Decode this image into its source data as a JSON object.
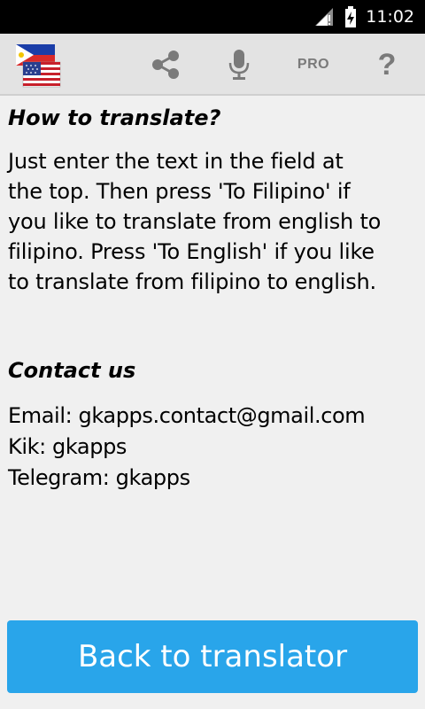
{
  "status_bar": {
    "time": "11:02",
    "icons": [
      "signal-icon",
      "battery-charging-icon"
    ]
  },
  "toolbar": {
    "logo": "flags-logo",
    "share_icon": "share-icon",
    "mic_icon": "microphone-icon",
    "pro_label": "PRO",
    "help_label": "?"
  },
  "content": {
    "howto_title": "How to translate?",
    "howto_lines": [
      "Just enter the text in the field at",
      "the top. Then press 'To Filipino' if",
      "you like to translate from english to",
      "filipino. Press 'To English' if you like",
      "to translate from filipino to english."
    ],
    "contact_title": "Contact us",
    "contact_lines": [
      "Email: gkapps.contact@gmail.com",
      "Kik: gkapps",
      "Telegram: gkapps"
    ]
  },
  "back_button": {
    "label": "Back to translator"
  },
  "colors": {
    "accent": "#29a5ea",
    "toolbar": "#e3e3e3",
    "background": "#f0f0f0"
  }
}
